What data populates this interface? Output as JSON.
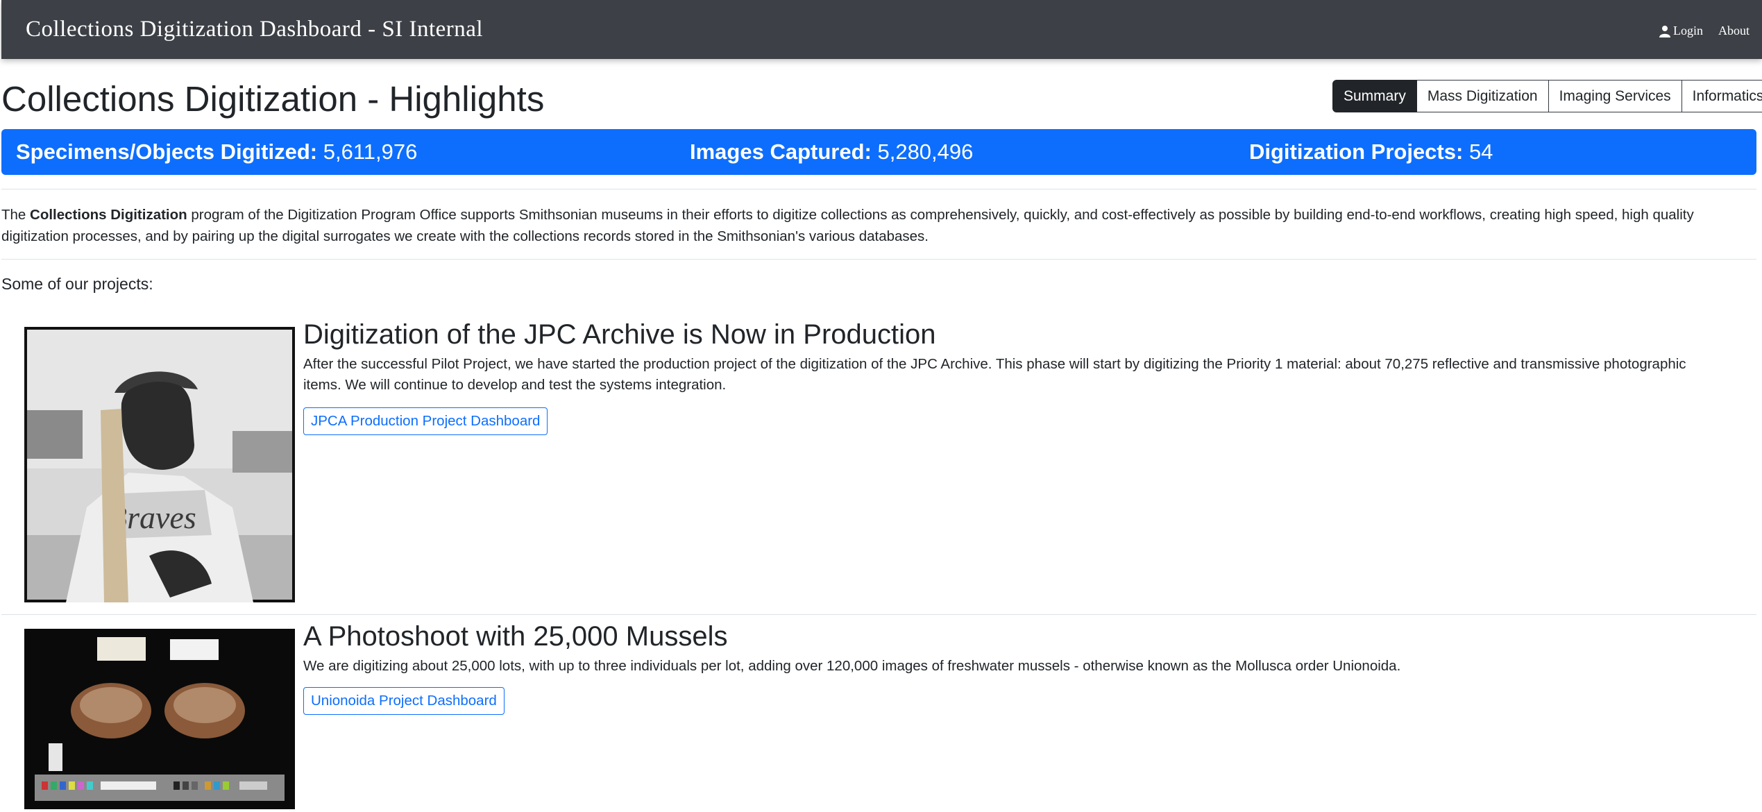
{
  "navbar": {
    "brand": "Collections Digitization Dashboard - SI Internal",
    "login_label": "Login",
    "about_label": "About"
  },
  "header": {
    "title": "Collections Digitization - Highlights"
  },
  "tabs": [
    {
      "label": "Summary",
      "active": true
    },
    {
      "label": "Mass Digitization",
      "active": false
    },
    {
      "label": "Imaging Services",
      "active": false
    },
    {
      "label": "Informatics",
      "active": false
    }
  ],
  "stats": {
    "specimens_label": "Specimens/Objects Digitized:",
    "specimens_value": "5,611,976",
    "images_label": "Images Captured:",
    "images_value": "5,280,496",
    "projects_label": "Digitization Projects:",
    "projects_value": "54"
  },
  "intro": {
    "prefix": "The ",
    "bold": "Collections Digitization",
    "rest": " program of the Digitization Program Office supports Smithsonian museums in their efforts to digitize collections as comprehensively, quickly, and cost-effectively as possible by building end-to-end workflows, creating high speed, high quality digitization processes, and by pairing up the digital surrogates we create with the collections records stored in the Smithsonian's various databases."
  },
  "projects_heading": "Some of our projects:",
  "projects": [
    {
      "title": "Digitization of the JPC Archive is Now in Production",
      "text": "After the successful Pilot Project, we have started the production project of the digitization of the JPC Archive. This phase will start by digitizing the Priority 1 material: about 70,275 reflective and transmissive photographic items. We will continue to develop and test the systems integration.",
      "button": "JPCA Production Project Dashboard"
    },
    {
      "title": "A Photoshoot with 25,000 Mussels",
      "text": "We are digitizing about 25,000 lots, with up to three individuals per lot, adding over 120,000 images of freshwater mussels - otherwise known as the Mollusca order Unionoida.",
      "button": "Unionoida Project Dashboard"
    }
  ],
  "colors": {
    "navbar_bg": "#3d4147",
    "stats_bg": "#0d6efd",
    "active_tab_bg": "#212529",
    "link_blue": "#0d6efd"
  },
  "icons": {
    "login": "user-icon"
  }
}
